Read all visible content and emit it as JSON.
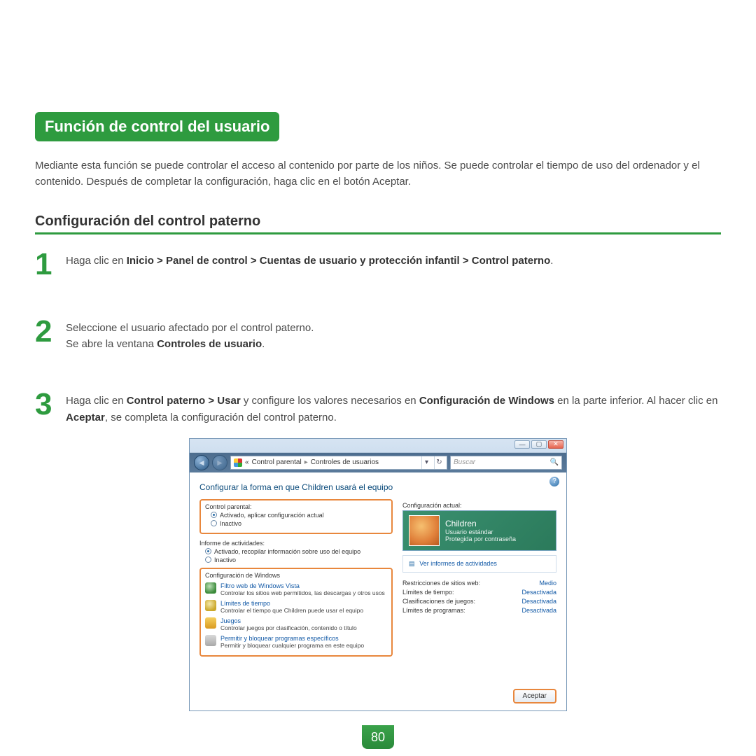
{
  "section_title": "Función de control del usuario",
  "intro": "Mediante esta función se puede controlar el acceso al contenido por parte de los niños. Se puede controlar el tiempo de uso del ordenador y el contenido. Después de completar la configuración, haga clic en el botón Aceptar.",
  "subheading": "Configuración del control paterno",
  "steps": {
    "s1": {
      "num": "1",
      "pre": "Haga clic en ",
      "bold": "Inicio > Panel de control > Cuentas de usuario y protección infantil > Control paterno",
      "post": "."
    },
    "s2": {
      "num": "2",
      "l1": "Seleccione el usuario afectado por el control paterno.",
      "l2a": "Se abre la ventana ",
      "l2b": "Controles de usuario",
      "l2c": "."
    },
    "s3": {
      "num": "3",
      "p1": "Haga clic en ",
      "b1": "Control paterno > Usar",
      "p2": " y configure los valores necesarios en ",
      "b2": "Configuración de Windows",
      "p3": " en la parte inferior. Al hacer clic en ",
      "b3": "Aceptar",
      "p4": ", se completa la configuración del control paterno."
    }
  },
  "window": {
    "breadcrumb1": "Control parental",
    "breadcrumb2": "Controles de usuarios",
    "search_placeholder": "Buscar",
    "heading": "Configurar la forma en que Children usará el equipo",
    "group_parental_label": "Control parental:",
    "opt_active": "Activado, aplicar configuración actual",
    "opt_inactive": "Inactivo",
    "section_report": "Informe de actividades:",
    "opt_report_on": "Activado, recopilar información sobre uso del equipo",
    "opt_report_off": "Inactivo",
    "wsettings_label": "Configuración de Windows",
    "witems": [
      {
        "title": "Filtro web de Windows Vista",
        "desc": "Controlar los sitios web permitidos, las descargas y otros usos"
      },
      {
        "title": "Límites de tiempo",
        "desc": "Controlar el tiempo que Children puede usar el equipo"
      },
      {
        "title": "Juegos",
        "desc": "Controlar juegos por clasificación, contenido o título"
      },
      {
        "title": "Permitir y bloquear programas específicos",
        "desc": "Permitir y bloquear cualquier programa en este equipo"
      }
    ],
    "right_heading": "Configuración actual:",
    "user_name": "Children",
    "user_role": "Usuario estándar",
    "user_pw": "Protegida por contraseña",
    "view_reports": "Ver informes de actividades",
    "stats": [
      {
        "label": "Restricciones de sitios web:",
        "value": "Medio"
      },
      {
        "label": "Límites de tiempo:",
        "value": "Desactivada"
      },
      {
        "label": "Clasificaciones de juegos:",
        "value": "Desactivada"
      },
      {
        "label": "Límites de programas:",
        "value": "Desactivada"
      }
    ],
    "ok": "Aceptar"
  },
  "page_number": "80"
}
